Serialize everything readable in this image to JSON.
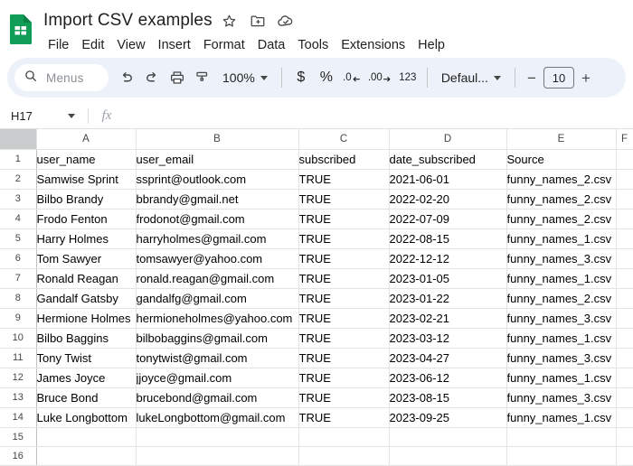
{
  "app": {
    "logo_name": "google-sheets-logo",
    "brand_green": "#0f9d58"
  },
  "header": {
    "doc_title": "Import CSV examples",
    "title_icons": [
      {
        "name": "star-icon",
        "label": "Star"
      },
      {
        "name": "move-to-folder-icon",
        "label": "Move"
      },
      {
        "name": "cloud-saved-icon",
        "label": "Saved to Drive"
      }
    ],
    "menus": [
      "File",
      "Edit",
      "View",
      "Insert",
      "Format",
      "Data",
      "Tools",
      "Extensions",
      "Help"
    ]
  },
  "toolbar": {
    "search_placeholder": "Menus",
    "undo_label": "Undo",
    "redo_label": "Redo",
    "print_label": "Print",
    "paint_format_label": "Paint format",
    "zoom_value": "100%",
    "currency_label": "$",
    "percent_label": "%",
    "decrease_decimal_label": ".0",
    "increase_decimal_label": ".00",
    "more_formats_label": "123",
    "font_value": "Defaul...",
    "decrease_font_label": "−",
    "font_size_value": "10",
    "increase_font_label": "+"
  },
  "formula_bar": {
    "name_box_value": "H17",
    "fx_label": "fx",
    "formula_value": ""
  },
  "grid": {
    "column_headers": [
      "A",
      "B",
      "C",
      "D",
      "E",
      "F"
    ],
    "row_headers": [
      "1",
      "2",
      "3",
      "4",
      "5",
      "6",
      "7",
      "8",
      "9",
      "10",
      "11",
      "12",
      "13",
      "14",
      "15",
      "16"
    ],
    "header_row": [
      "user_name",
      "user_email",
      "subscribed",
      "date_subscribed",
      "Source",
      ""
    ],
    "rows": [
      [
        "Samwise Sprint",
        "ssprint@outlook.com",
        "TRUE",
        "2021-06-01",
        "funny_names_2.csv",
        ""
      ],
      [
        "Bilbo Brandy",
        "bbrandy@gmail.net",
        "TRUE",
        "2022-02-20",
        "funny_names_2.csv",
        ""
      ],
      [
        "Frodo Fenton",
        "frodonot@gmail.com",
        "TRUE",
        "2022-07-09",
        "funny_names_2.csv",
        ""
      ],
      [
        "Harry Holmes",
        "harryholmes@gmail.com",
        "TRUE",
        "2022-08-15",
        "funny_names_1.csv",
        ""
      ],
      [
        "Tom Sawyer",
        "tomsawyer@yahoo.com",
        "TRUE",
        "2022-12-12",
        "funny_names_3.csv",
        ""
      ],
      [
        "Ronald Reagan",
        "ronald.reagan@gmail.com",
        "TRUE",
        "2023-01-05",
        "funny_names_1.csv",
        ""
      ],
      [
        "Gandalf Gatsby",
        "gandalfg@gmail.com",
        "TRUE",
        "2023-01-22",
        "funny_names_2.csv",
        ""
      ],
      [
        "Hermione Holmes",
        "hermioneholmes@yahoo.com",
        "TRUE",
        "2023-02-21",
        "funny_names_3.csv",
        ""
      ],
      [
        "Bilbo Baggins",
        "bilbobaggins@gmail.com",
        "TRUE",
        "2023-03-12",
        "funny_names_1.csv",
        ""
      ],
      [
        "Tony Twist",
        "tonytwist@gmail.com",
        "TRUE",
        "2023-04-27",
        "funny_names_3.csv",
        ""
      ],
      [
        "James Joyce",
        "jjoyce@gmail.com",
        "TRUE",
        "2023-06-12",
        "funny_names_1.csv",
        ""
      ],
      [
        "Bruce Bond",
        "brucebond@gmail.com",
        "TRUE",
        "2023-08-15",
        "funny_names_3.csv",
        ""
      ],
      [
        "Luke Longbottom",
        "lukeLongbottom@gmail.com",
        "TRUE",
        "2023-09-25",
        "funny_names_1.csv",
        ""
      ],
      [
        "",
        "",
        "",
        "",
        "",
        ""
      ],
      [
        "",
        "",
        "",
        "",
        "",
        ""
      ]
    ]
  }
}
